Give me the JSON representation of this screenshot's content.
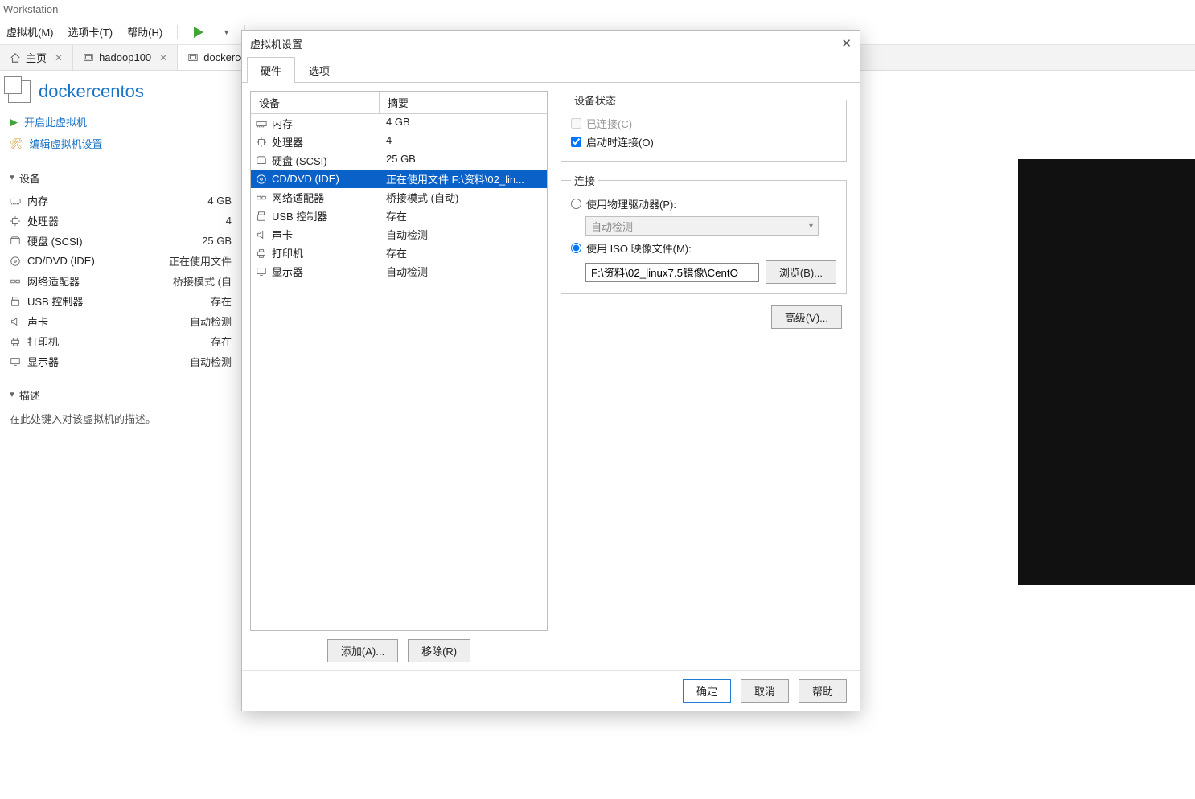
{
  "window": {
    "title": "Workstation"
  },
  "menus": {
    "vm": "虚拟机(M)",
    "tabs": "选项卡(T)",
    "help": "帮助(H)"
  },
  "tabs": {
    "home": "主页",
    "hadoop": "hadoop100",
    "docker": "dockercentos"
  },
  "vm": {
    "name": "dockercentos",
    "power_on": "开启此虚拟机",
    "edit_settings": "编辑虚拟机设置"
  },
  "sections": {
    "devices": "设备",
    "description": "描述",
    "description_placeholder": "在此处键入对该虚拟机的描述。"
  },
  "side_devices": [
    {
      "icon": "memory",
      "label": "内存",
      "value": "4 GB"
    },
    {
      "icon": "cpu",
      "label": "处理器",
      "value": "4"
    },
    {
      "icon": "disk",
      "label": "硬盘 (SCSI)",
      "value": "25 GB"
    },
    {
      "icon": "cd",
      "label": "CD/DVD (IDE)",
      "value": "正在使用文件"
    },
    {
      "icon": "net",
      "label": "网络适配器",
      "value": "桥接模式 (自"
    },
    {
      "icon": "usb",
      "label": "USB 控制器",
      "value": "存在"
    },
    {
      "icon": "sound",
      "label": "声卡",
      "value": "自动检测"
    },
    {
      "icon": "printer",
      "label": "打印机",
      "value": "存在"
    },
    {
      "icon": "display",
      "label": "显示器",
      "value": "自动检测"
    }
  ],
  "dialog": {
    "title": "虚拟机设置",
    "tabs": {
      "hardware": "硬件",
      "options": "选项"
    },
    "cols": {
      "device": "设备",
      "summary": "摘要"
    },
    "devices": [
      {
        "icon": "memory",
        "label": "内存",
        "summary": "4 GB",
        "sel": false
      },
      {
        "icon": "cpu",
        "label": "处理器",
        "summary": "4",
        "sel": false
      },
      {
        "icon": "disk",
        "label": "硬盘 (SCSI)",
        "summary": "25 GB",
        "sel": false
      },
      {
        "icon": "cd",
        "label": "CD/DVD (IDE)",
        "summary": "正在使用文件 F:\\资料\\02_lin...",
        "sel": true
      },
      {
        "icon": "net",
        "label": "网络适配器",
        "summary": "桥接模式 (自动)",
        "sel": false
      },
      {
        "icon": "usb",
        "label": "USB 控制器",
        "summary": "存在",
        "sel": false
      },
      {
        "icon": "sound",
        "label": "声卡",
        "summary": "自动检测",
        "sel": false
      },
      {
        "icon": "printer",
        "label": "打印机",
        "summary": "存在",
        "sel": false
      },
      {
        "icon": "display",
        "label": "显示器",
        "summary": "自动检测",
        "sel": false
      }
    ],
    "add": "添加(A)...",
    "remove": "移除(R)",
    "status": {
      "legend": "设备状态",
      "connected": "已连接(C)",
      "connect_at_power": "启动时连接(O)"
    },
    "connection": {
      "legend": "连接",
      "physical": "使用物理驱动器(P):",
      "auto_detect": "自动检测",
      "iso": "使用 ISO 映像文件(M):",
      "iso_path": "F:\\资料\\02_linux7.5镜像\\CentO",
      "browse": "浏览(B)..."
    },
    "advanced": "高级(V)...",
    "ok": "确定",
    "cancel": "取消",
    "help": "帮助"
  }
}
